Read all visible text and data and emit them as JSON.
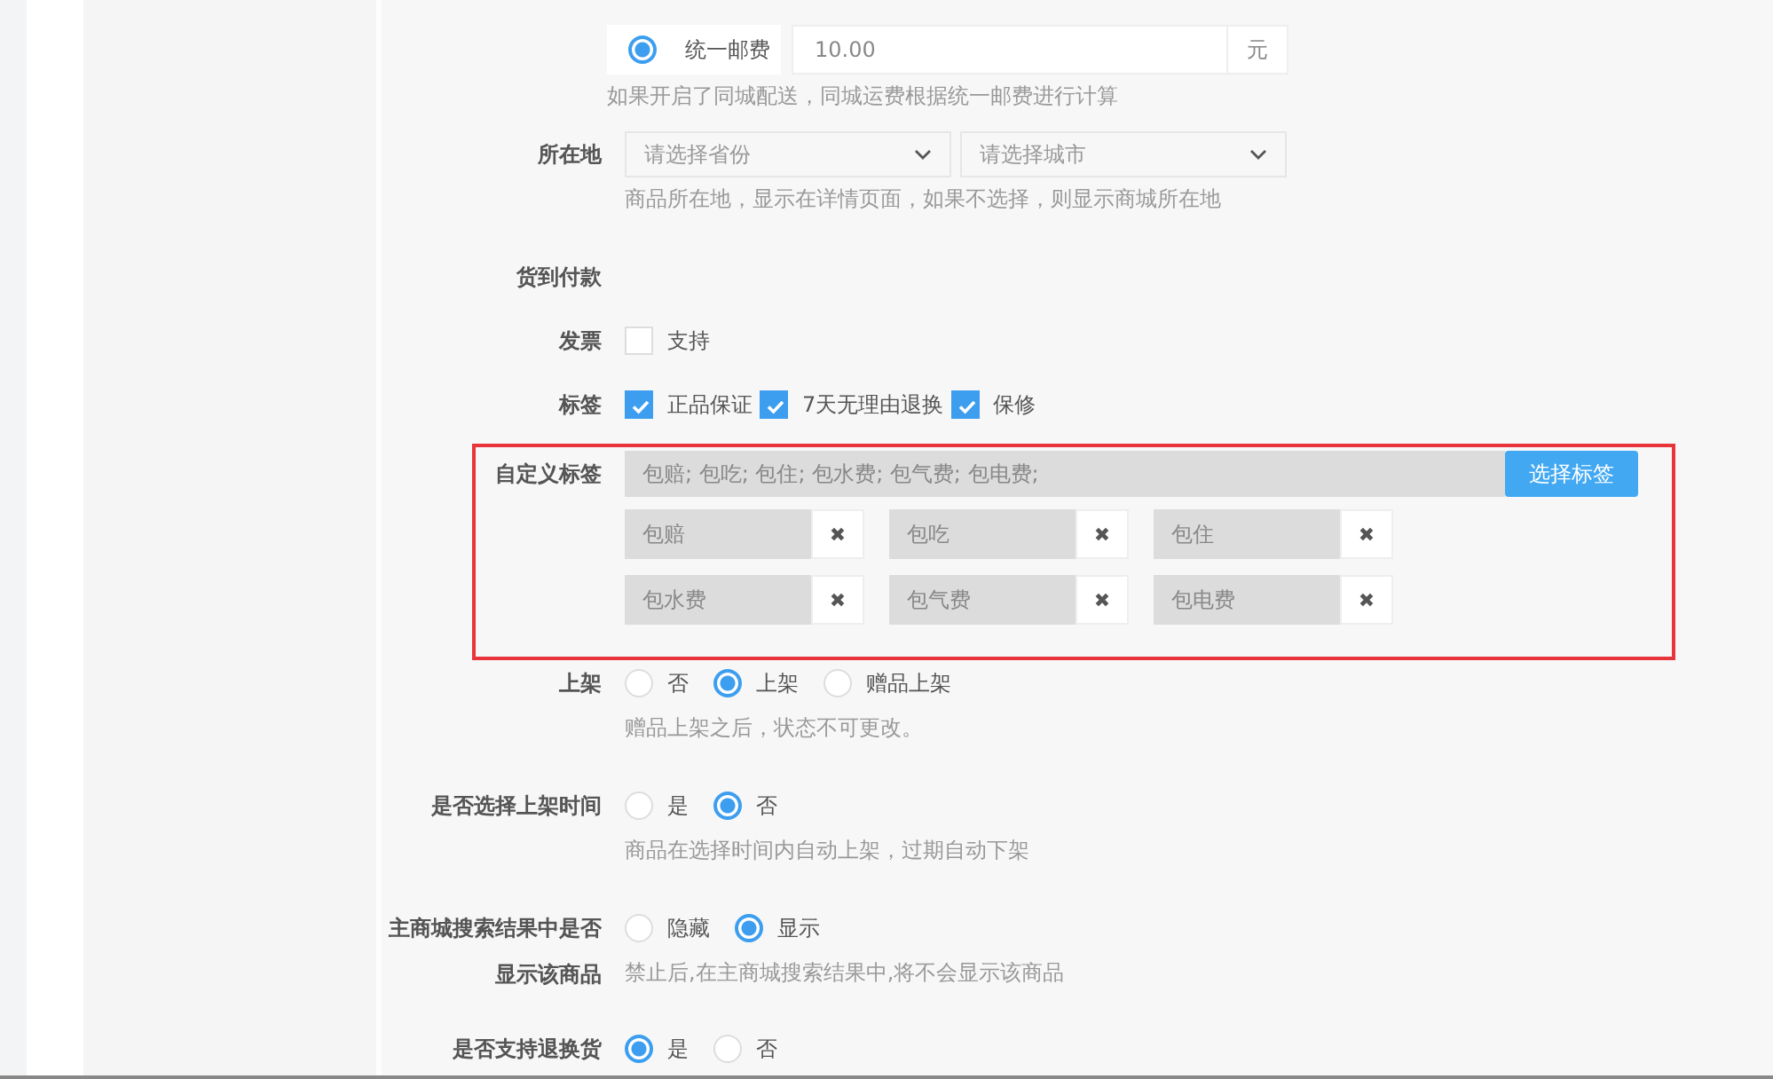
{
  "shipping": {
    "option": {
      "label": "统一邮费",
      "selected": true
    },
    "value": "10.00",
    "unit": "元",
    "hint": "如果开启了同城配送，同城运费根据统一邮费进行计算"
  },
  "fields": [
    {
      "kind": "selects",
      "label": "所在地",
      "selects": [
        {
          "placeholder": "请选择省份"
        },
        {
          "placeholder": "请选择城市"
        }
      ],
      "hint": "商品所在地，显示在详情页面，如果不选择，则显示商城所在地"
    },
    {
      "kind": "empty",
      "label": "货到付款"
    },
    {
      "kind": "checkboxes",
      "label": "发票",
      "options": [
        {
          "label": "支持",
          "checked": false
        }
      ]
    },
    {
      "kind": "checkboxes",
      "label": "标签",
      "options": [
        {
          "label": "正品保证",
          "checked": true
        },
        {
          "label": "7天无理由退换",
          "checked": true
        },
        {
          "label": "保修",
          "checked": true
        }
      ]
    },
    {
      "kind": "tags",
      "label": "自定义标签",
      "highlighted": true,
      "value": "包赔; 包吃; 包住; 包水费; 包气费; 包电费;",
      "button": "选择标签",
      "tags": [
        {
          "text": "包赔",
          "remove": "✖"
        },
        {
          "text": "包吃",
          "remove": "✖"
        },
        {
          "text": "包住",
          "remove": "✖"
        },
        {
          "text": "包水费",
          "remove": "✖"
        },
        {
          "text": "包气费",
          "remove": "✖"
        },
        {
          "text": "包电费",
          "remove": "✖"
        }
      ]
    },
    {
      "kind": "radios",
      "label": "上架",
      "options": [
        {
          "label": "否",
          "selected": false
        },
        {
          "label": "上架",
          "selected": true
        },
        {
          "label": "赠品上架",
          "selected": false
        }
      ],
      "hint": "赠品上架之后，状态不可更改。"
    },
    {
      "kind": "radios",
      "label": "是否选择上架时间",
      "options": [
        {
          "label": "是",
          "selected": false
        },
        {
          "label": "否",
          "selected": true
        }
      ],
      "hint": "商品在选择时间内自动上架，过期自动下架"
    },
    {
      "kind": "radios",
      "label": "主商城搜索结果中是否显示该商品",
      "options": [
        {
          "label": "隐藏",
          "selected": false
        },
        {
          "label": "显示",
          "selected": true
        }
      ],
      "hint": "禁止后,在主商城搜索结果中,将不会显示该商品"
    },
    {
      "kind": "radios",
      "label": "是否支持退换货",
      "options": [
        {
          "label": "是",
          "selected": true
        },
        {
          "label": "否",
          "selected": false
        }
      ]
    }
  ]
}
